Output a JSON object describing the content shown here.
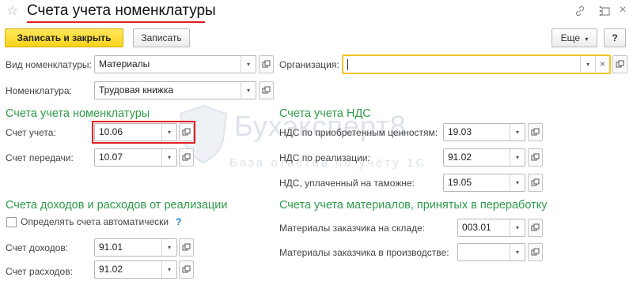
{
  "window": {
    "title": "Счета учета номенклатуры",
    "star_icon": "star-icon",
    "link_icon": "link-icon",
    "maximize_icon": "maximize-icon",
    "close_icon": "close-icon",
    "accent_color": "#e31e24"
  },
  "toolbar": {
    "save_close_label": "Записать и закрыть",
    "save_label": "Записать",
    "more_label": "Еще",
    "help_label": "?"
  },
  "header": {
    "nom_type_label": "Вид номенклатуры:",
    "nom_type_value": "Материалы",
    "nom_label": "Номенклатура:",
    "nom_value": "Трудовая книжка",
    "org_label": "Организация:",
    "org_value": ""
  },
  "nom_accounts": {
    "title": "Счета учета номенклатуры",
    "account_label": "Счет учета:",
    "account_value": "10.06",
    "transfer_label": "Счет передачи:",
    "transfer_value": "10.07"
  },
  "vat_accounts": {
    "title": "Счета учета НДС",
    "acquired_label": "НДС по приобретенным ценностям:",
    "acquired_value": "19.03",
    "sales_label": "НДС по реализации:",
    "sales_value": "91.02",
    "customs_label": "НДС, уплаченный на таможне:",
    "customs_value": "19.05"
  },
  "income_expense": {
    "title": "Счета доходов и расходов от реализации",
    "auto_label": "Определять счета автоматически",
    "auto_checked": false,
    "help_mark": "?",
    "income_label": "Счет доходов:",
    "income_value": "91.01",
    "expense_label": "Счет расходов:",
    "expense_value": "91.02"
  },
  "processing": {
    "title": "Счета учета материалов, принятых в переработку",
    "warehouse_label": "Материалы заказчика на складе:",
    "warehouse_value": "003.01",
    "production_label": "Материалы заказчика в производстве:",
    "production_value": ""
  },
  "watermark": {
    "line1": "Бухэксперт8",
    "line2": "База ответов по учёту 1С"
  }
}
